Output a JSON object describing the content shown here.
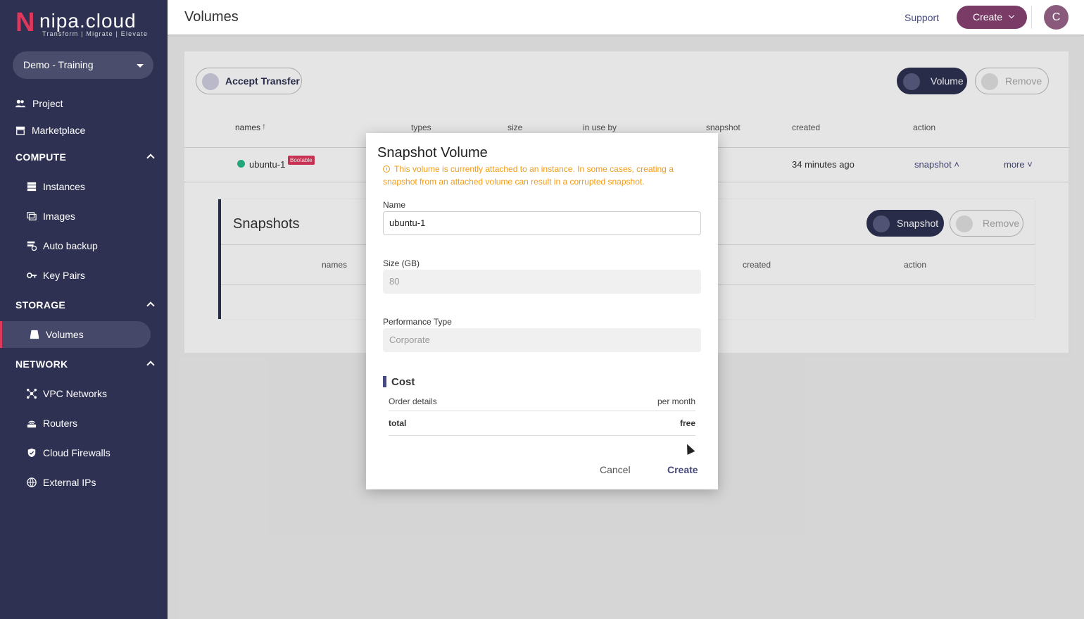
{
  "brand": {
    "logo_letter": "N",
    "logo_text": "nipa.cloud",
    "tagline": "Transform | Migrate | Elevate"
  },
  "project_selector": {
    "value": "Demo - Training"
  },
  "sidebar": {
    "items": [
      {
        "label": "Project",
        "icon": "people-icon"
      },
      {
        "label": "Marketplace",
        "icon": "store-icon"
      }
    ],
    "sections": [
      {
        "title": "COMPUTE",
        "items": [
          {
            "label": "Instances",
            "icon": "server-icon"
          },
          {
            "label": "Images",
            "icon": "image-icon"
          },
          {
            "label": "Auto backup",
            "icon": "backup-icon"
          },
          {
            "label": "Key Pairs",
            "icon": "key-icon"
          }
        ]
      },
      {
        "title": "STORAGE",
        "items": [
          {
            "label": "Volumes",
            "icon": "disk-icon"
          }
        ]
      },
      {
        "title": "NETWORK",
        "items": [
          {
            "label": "VPC Networks",
            "icon": "network-icon"
          },
          {
            "label": "Routers",
            "icon": "router-icon"
          },
          {
            "label": "Cloud Firewalls",
            "icon": "shield-icon"
          },
          {
            "label": "External IPs",
            "icon": "globe-icon"
          }
        ]
      }
    ]
  },
  "header": {
    "title": "Volumes",
    "support": "Support",
    "create": "Create",
    "avatar_letter": "C"
  },
  "main": {
    "accept_transfer": "Accept Transfer",
    "volume_button": "Volume",
    "remove_button": "Remove",
    "columns": [
      "names",
      "types",
      "size",
      "in use by",
      "snapshot",
      "created",
      "action"
    ],
    "rows": [
      {
        "name": "ubuntu-1",
        "badge": "Bootable",
        "created": "34 minutes ago",
        "action_snapshot": "snapshot",
        "action_more": "more"
      }
    ],
    "snapshots": {
      "title": "Snapshots",
      "snapshot_button": "Snapshot",
      "remove_button": "Remove",
      "columns": [
        "names",
        "created",
        "action"
      ]
    }
  },
  "modal": {
    "title": "Snapshot Volume",
    "warning": "This volume is currently attached to an instance. In some cases, creating a snapshot from an attached volume can result in a corrupted snapshot.",
    "name_label": "Name",
    "name_value": "ubuntu-1",
    "size_label": "Size (GB)",
    "size_value": "80",
    "perf_label": "Performance Type",
    "perf_value": "Corporate",
    "cost_title": "Cost",
    "cost_header_left": "Order details",
    "cost_header_right": "per month",
    "total_label": "total",
    "total_value": "free",
    "cancel": "Cancel",
    "create": "Create"
  },
  "colors": {
    "sidebar": "#2e3152",
    "accent": "#e0375d",
    "warning": "#f29b15",
    "primary": "#464a7e"
  }
}
